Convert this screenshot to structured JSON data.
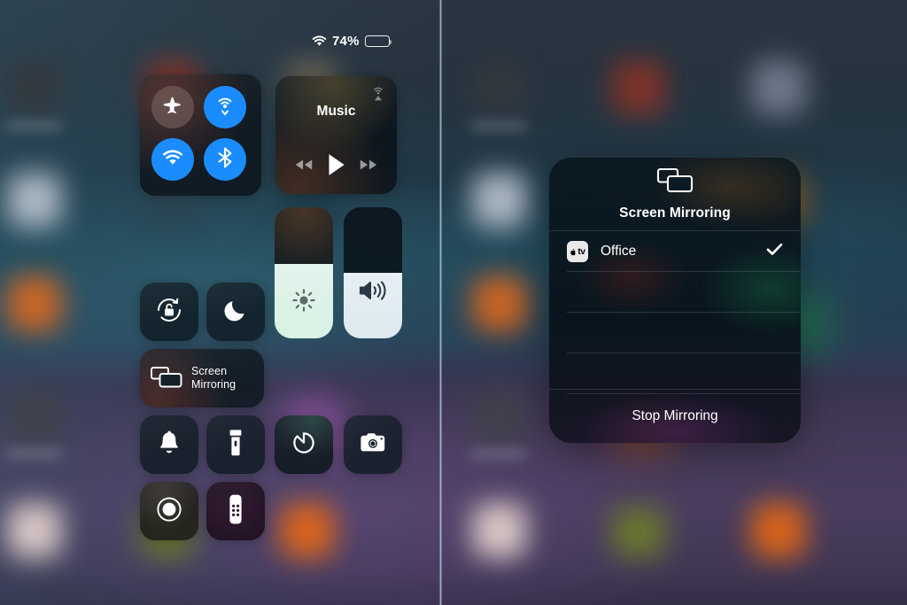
{
  "statusbar": {
    "wifi_icon": "wifi-icon",
    "battery_percent": "74%",
    "battery_level": 74
  },
  "control_center": {
    "connectivity": {
      "airplane": {
        "label": "Airplane Mode",
        "icon": "airplane-icon",
        "state": "off"
      },
      "airdrop": {
        "label": "AirDrop",
        "icon": "airdrop-icon",
        "state": "on"
      },
      "wifi": {
        "label": "Wi-Fi",
        "icon": "wifi-icon",
        "state": "on"
      },
      "bluetooth": {
        "label": "Bluetooth",
        "icon": "bluetooth-icon",
        "state": "on"
      }
    },
    "music": {
      "title": "Music",
      "airplay_icon": "airplay-icon",
      "prev_icon": "rewind-icon",
      "play_icon": "play-icon",
      "next_icon": "fast-forward-icon"
    },
    "rotation_lock": {
      "label": "Rotation Lock",
      "icon": "rotation-lock-icon"
    },
    "do_not_disturb": {
      "label": "Do Not Disturb",
      "icon": "moon-icon"
    },
    "screen_mirroring_tile": {
      "label_line1": "Screen",
      "label_line2": "Mirroring",
      "icon": "screen-mirroring-icon"
    },
    "brightness": {
      "label": "Brightness",
      "icon": "brightness-icon",
      "value": 57
    },
    "volume": {
      "label": "Volume",
      "icon": "volume-icon",
      "value": 50
    },
    "alarm": {
      "label": "Alarm",
      "icon": "bell-icon"
    },
    "flashlight": {
      "label": "Flashlight",
      "icon": "flashlight-icon"
    },
    "timer": {
      "label": "Timer",
      "icon": "timer-icon"
    },
    "camera": {
      "label": "Camera",
      "icon": "camera-icon"
    },
    "screen_record": {
      "label": "Screen Recording",
      "icon": "record-icon"
    },
    "apple_tv_remote": {
      "label": "Apple TV Remote",
      "icon": "remote-icon"
    }
  },
  "mirror_dialog": {
    "icon": "screen-mirroring-icon",
    "title": "Screen Mirroring",
    "devices": [
      {
        "badge_text": "tv",
        "badge_icon": "apple-logo-icon",
        "name": "Office",
        "selected": true,
        "check_icon": "checkmark-icon"
      }
    ],
    "empty_row_count": 3,
    "footer_label": "Stop Mirroring"
  },
  "colors": {
    "accent_blue": "#1b8cfe",
    "tile_bg": "#0e1921",
    "slider_fill": "#e4f0ef",
    "text_primary": "#ffffff"
  }
}
